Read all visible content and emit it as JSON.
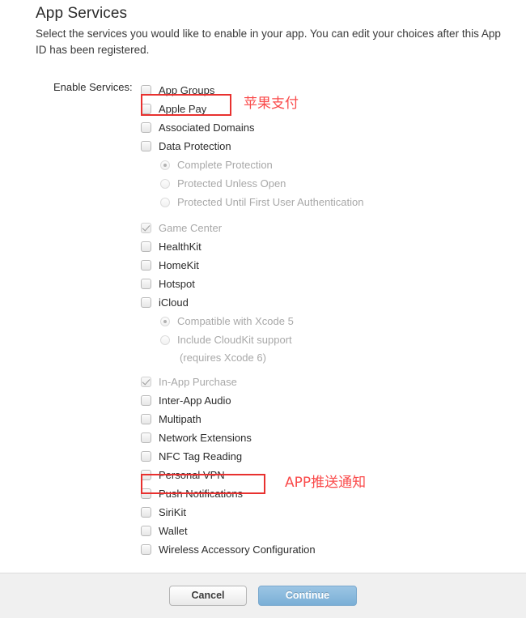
{
  "header": {
    "title": "App Services",
    "subtitle": "Select the services you would like to enable in your app. You can edit your choices after this App ID has been registered."
  },
  "form": {
    "enable_services_label": "Enable Services:",
    "items": [
      {
        "label": "App Groups",
        "control": "checkbox",
        "checked": false,
        "disabled": false,
        "indent": 0
      },
      {
        "label": "Apple Pay",
        "control": "checkbox",
        "checked": false,
        "disabled": false,
        "indent": 0
      },
      {
        "label": "Associated Domains",
        "control": "checkbox",
        "checked": false,
        "disabled": false,
        "indent": 0
      },
      {
        "label": "Data Protection",
        "control": "checkbox",
        "checked": false,
        "disabled": false,
        "indent": 0
      },
      {
        "label": "Complete Protection",
        "control": "radio",
        "checked": true,
        "disabled": true,
        "indent": 1
      },
      {
        "label": "Protected Unless Open",
        "control": "radio",
        "checked": false,
        "disabled": true,
        "indent": 1
      },
      {
        "label": "Protected Until First User Authentication",
        "control": "radio",
        "checked": false,
        "disabled": true,
        "indent": 1
      },
      {
        "label": "Game Center",
        "control": "checkbox",
        "checked": true,
        "disabled": true,
        "indent": 0,
        "gap": true
      },
      {
        "label": "HealthKit",
        "control": "checkbox",
        "checked": false,
        "disabled": false,
        "indent": 0
      },
      {
        "label": "HomeKit",
        "control": "checkbox",
        "checked": false,
        "disabled": false,
        "indent": 0
      },
      {
        "label": "Hotspot",
        "control": "checkbox",
        "checked": false,
        "disabled": false,
        "indent": 0
      },
      {
        "label": "iCloud",
        "control": "checkbox",
        "checked": false,
        "disabled": false,
        "indent": 0
      },
      {
        "label": "Compatible with Xcode 5",
        "control": "radio",
        "checked": true,
        "disabled": true,
        "indent": 1
      },
      {
        "label": "Include CloudKit support",
        "control": "radio",
        "checked": false,
        "disabled": true,
        "indent": 1
      },
      {
        "label": "(requires Xcode 6)",
        "control": "none",
        "checked": false,
        "disabled": true,
        "indent": 2
      },
      {
        "label": "In-App Purchase",
        "control": "checkbox",
        "checked": true,
        "disabled": true,
        "indent": 0,
        "gap": true
      },
      {
        "label": "Inter-App Audio",
        "control": "checkbox",
        "checked": false,
        "disabled": false,
        "indent": 0
      },
      {
        "label": "Multipath",
        "control": "checkbox",
        "checked": false,
        "disabled": false,
        "indent": 0
      },
      {
        "label": "Network Extensions",
        "control": "checkbox",
        "checked": false,
        "disabled": false,
        "indent": 0
      },
      {
        "label": "NFC Tag Reading",
        "control": "checkbox",
        "checked": false,
        "disabled": false,
        "indent": 0
      },
      {
        "label": "Personal VPN",
        "control": "checkbox",
        "checked": false,
        "disabled": false,
        "indent": 0
      },
      {
        "label": "Push Notifications",
        "control": "checkbox",
        "checked": false,
        "disabled": false,
        "indent": 0
      },
      {
        "label": "SiriKit",
        "control": "checkbox",
        "checked": false,
        "disabled": false,
        "indent": 0
      },
      {
        "label": "Wallet",
        "control": "checkbox",
        "checked": false,
        "disabled": false,
        "indent": 0
      },
      {
        "label": "Wireless Accessory Configuration",
        "control": "checkbox",
        "checked": false,
        "disabled": false,
        "indent": 0
      }
    ]
  },
  "annotations": {
    "color": "#fa4b4b",
    "box_color": "#e8312f",
    "apple_pay_text": "苹果支付",
    "push_notifications_text": "APP推送通知"
  },
  "footer": {
    "cancel_label": "Cancel",
    "continue_label": "Continue",
    "continue_color": "#7aafd6"
  }
}
